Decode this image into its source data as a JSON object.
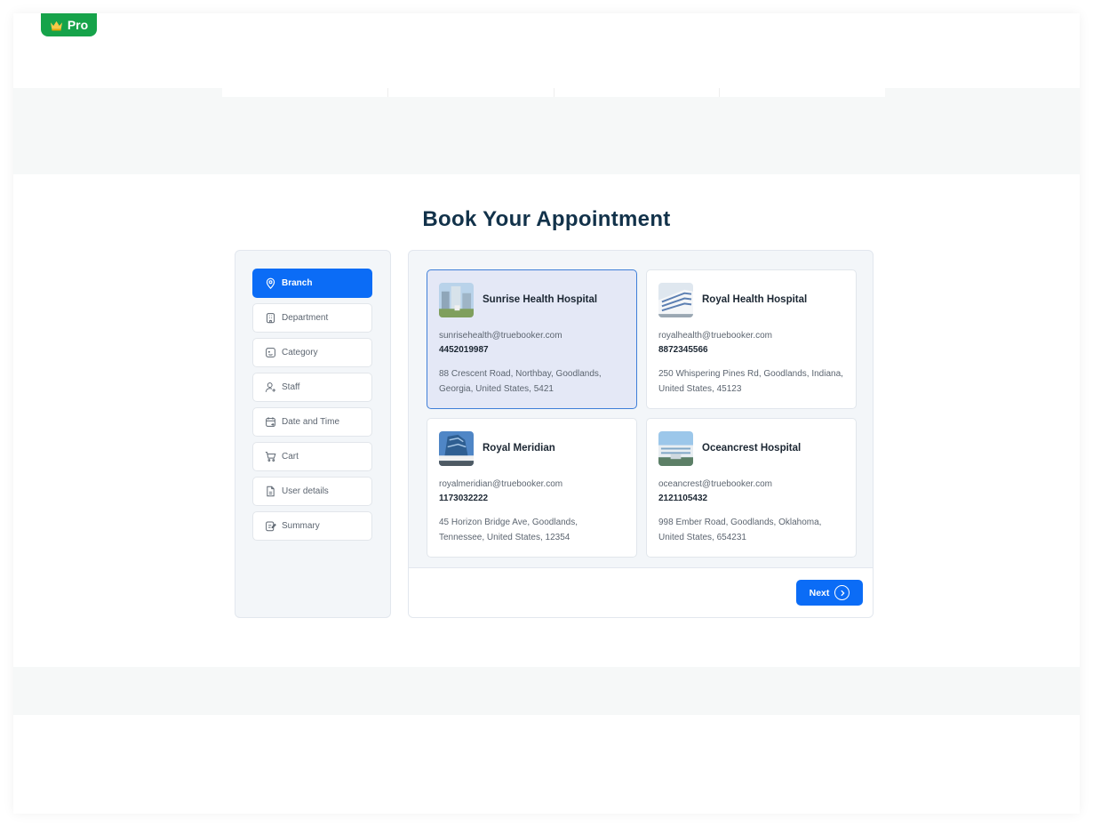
{
  "badge": {
    "label": "Pro"
  },
  "page": {
    "title": "Book Your Appointment"
  },
  "steps": [
    {
      "label": "Branch",
      "icon": "map-pin-icon",
      "active": true
    },
    {
      "label": "Department",
      "icon": "building-icon",
      "active": false
    },
    {
      "label": "Category",
      "icon": "category-icon",
      "active": false
    },
    {
      "label": "Staff",
      "icon": "user-add-icon",
      "active": false
    },
    {
      "label": "Date and Time",
      "icon": "calendar-icon",
      "active": false
    },
    {
      "label": "Cart",
      "icon": "cart-icon",
      "active": false
    },
    {
      "label": "User details",
      "icon": "document-icon",
      "active": false
    },
    {
      "label": "Summary",
      "icon": "summary-icon",
      "active": false
    }
  ],
  "branches": [
    {
      "name": "Sunrise Health Hospital",
      "email": "sunrisehealth@truebooker.com",
      "phone": "4452019987",
      "address": "88 Crescent Road, Northbay, Goodlands, Georgia, United States, 5421",
      "selected": true
    },
    {
      "name": "Royal Health Hospital",
      "email": "royalhealth@truebooker.com",
      "phone": "8872345566",
      "address": "250 Whispering Pines Rd, Goodlands, Indiana, United States, 45123",
      "selected": false
    },
    {
      "name": "Royal Meridian",
      "email": "royalmeridian@truebooker.com",
      "phone": "1173032222",
      "address": "45 Horizon Bridge Ave, Goodlands, Tennessee, United States, 12354",
      "selected": false
    },
    {
      "name": "Oceancrest Hospital",
      "email": "oceancrest@truebooker.com",
      "phone": "2121105432",
      "address": "998 Ember Road, Goodlands, Oklahoma, United States, 654231",
      "selected": false
    }
  ],
  "footer": {
    "next_label": "Next"
  },
  "colors": {
    "primary": "#0b6cf6",
    "selected_card": "#e4e8f6",
    "title": "#12324a",
    "pro_badge": "#16a34a"
  }
}
